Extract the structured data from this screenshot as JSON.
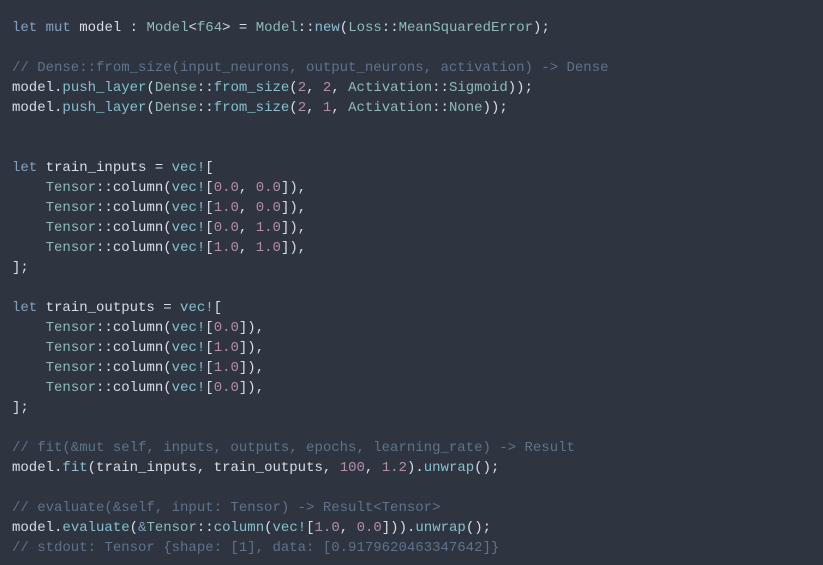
{
  "code_tokens": {
    "let": "let",
    "mut": "mut",
    "model_decl": " model : ",
    "Model": "Model",
    "f64": "f64",
    "eq": " = ",
    "new": "new",
    "Loss": "Loss",
    "MeanSquaredError": "MeanSquaredError",
    "semi": ";",
    "Dense_comment": "// Dense::from_size(input_neurons, output_neurons, activation) -> Dense",
    "model": "model",
    "push_layer": "push_layer",
    "Dense": "Dense",
    "from_size": "from_size",
    "Activation": "Activation",
    "Sigmoid": "Sigmoid",
    "None": "None",
    "n2": "2",
    "n1": "1",
    "train_inputs_decl": " train_inputs = ",
    "train_outputs_decl": " train_outputs = ",
    "vecbang": "vec!",
    "Tensor": "Tensor",
    "column": "column",
    "n0_0": "0.0",
    "n1_0": "1.0",
    "fit_comment": "// fit(&mut self, inputs, outputs, epochs, learning_rate) -> Result",
    "fit": "fit",
    "fit_args": "(train_inputs, train_outputs, ",
    "n100": "100",
    "n1_2": "1.2",
    "unwrap": "unwrap",
    "eval_comment": "// evaluate(&self, input: Tensor) -> Result<Tensor>",
    "evaluate": "evaluate",
    "amp": "&",
    "stdout_comment": "// stdout: Tensor {shape: [1], data: [0.9179620463347642]}"
  }
}
